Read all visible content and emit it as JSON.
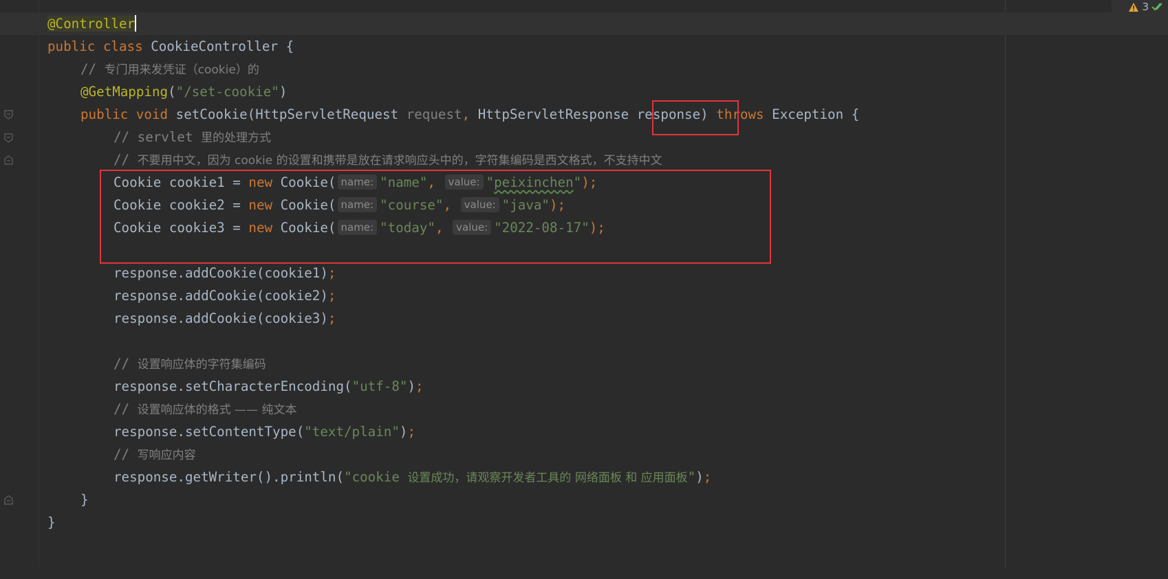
{
  "editor": {
    "language": "java",
    "lines": {
      "l1": {
        "annotation": "@Controller"
      },
      "l2": {
        "kw_public": "public",
        "kw_class": "class",
        "class_name": "CookieController",
        "brace": " {"
      },
      "l3": {
        "comment_prefix": "// ",
        "comment_text": "专门用来发凭证（cookie）的"
      },
      "l4": {
        "annotation": "@GetMapping",
        "open": "(",
        "path": "\"/set-cookie\"",
        "close": ")"
      },
      "l5": {
        "kw_public": "public",
        "kw_void": "void",
        "method": "setCookie",
        "open": "(",
        "type1": "HttpServletRequest",
        "param1": "request",
        "comma": ",",
        "type2": "HttpServletResponse",
        "param2": "response",
        "close": ")",
        "kw_throws": "throws",
        "exception": "Exception",
        "brace": " {"
      },
      "l6": {
        "comment_prefix": "// servlet ",
        "comment_text": "里的处理方式"
      },
      "l7": {
        "comment_prefix": "// ",
        "comment_text": "不要用中文，因为 cookie 的设置和携带是放在请求响应头中的，字符集编码是西文格式，不支持中文"
      },
      "l8": {
        "type": "Cookie",
        "var": "cookie1",
        "eq": " = ",
        "kw_new": "new",
        "ctor": "Cookie(",
        "hint_name": "name:",
        "arg1": "\"name\"",
        "comma": ",",
        "hint_value": "value:",
        "arg2_q1": "\"",
        "arg2": "peixinchen",
        "arg2_q2": "\"",
        "end": ");"
      },
      "l9": {
        "type": "Cookie",
        "var": "cookie2",
        "eq": " = ",
        "kw_new": "new",
        "ctor": "Cookie(",
        "hint_name": "name:",
        "arg1": "\"course\"",
        "comma": ",",
        "hint_value": "value:",
        "arg2": "\"java\"",
        "end": ");"
      },
      "l10": {
        "type": "Cookie",
        "var": "cookie3",
        "eq": " = ",
        "kw_new": "new",
        "ctor": "Cookie(",
        "hint_name": "name:",
        "arg1": "\"today\"",
        "comma": ",",
        "hint_value": "value:",
        "arg2": "\"2022-08-17\"",
        "end": ");"
      },
      "l12": {
        "call": "response.addCookie(cookie1)",
        "semi": ";"
      },
      "l13": {
        "call": "response.addCookie(cookie2)",
        "semi": ";"
      },
      "l14": {
        "call": "response.addCookie(cookie3)",
        "semi": ";"
      },
      "l16": {
        "comment_prefix": "// ",
        "comment_text": "设置响应体的字符集编码"
      },
      "l17": {
        "call": "response.setCharacterEncoding(",
        "arg": "\"utf-8\"",
        "close": ")",
        "semi": ";"
      },
      "l18": {
        "comment_prefix": "// ",
        "comment_text": "设置响应体的格式 —— 纯文本"
      },
      "l19": {
        "call": "response.setContentType(",
        "arg": "\"text/plain\"",
        "close": ")",
        "semi": ";"
      },
      "l20": {
        "comment_prefix": "// ",
        "comment_text": "写响应内容"
      },
      "l21": {
        "call": "response.getWriter().println(",
        "arg_q1": "\"cookie ",
        "arg_cn": "设置成功，请观察开发者工具的 网络面板 和 应用面板",
        "arg_q2": "\"",
        "close": ")",
        "semi": ";"
      },
      "l22": {
        "brace": "}"
      },
      "l23": {
        "brace": "}"
      }
    }
  },
  "status": {
    "warning_count": "3",
    "warning_icon": "warning-triangle-icon",
    "check_icon": "double-check-icon"
  },
  "colors": {
    "background": "#2b2b2b",
    "keyword": "#cc7832",
    "annotation": "#bbb529",
    "string": "#6a8759",
    "comment": "#808080",
    "text": "#a9b7c6",
    "highlight_box": "#e0353b"
  }
}
